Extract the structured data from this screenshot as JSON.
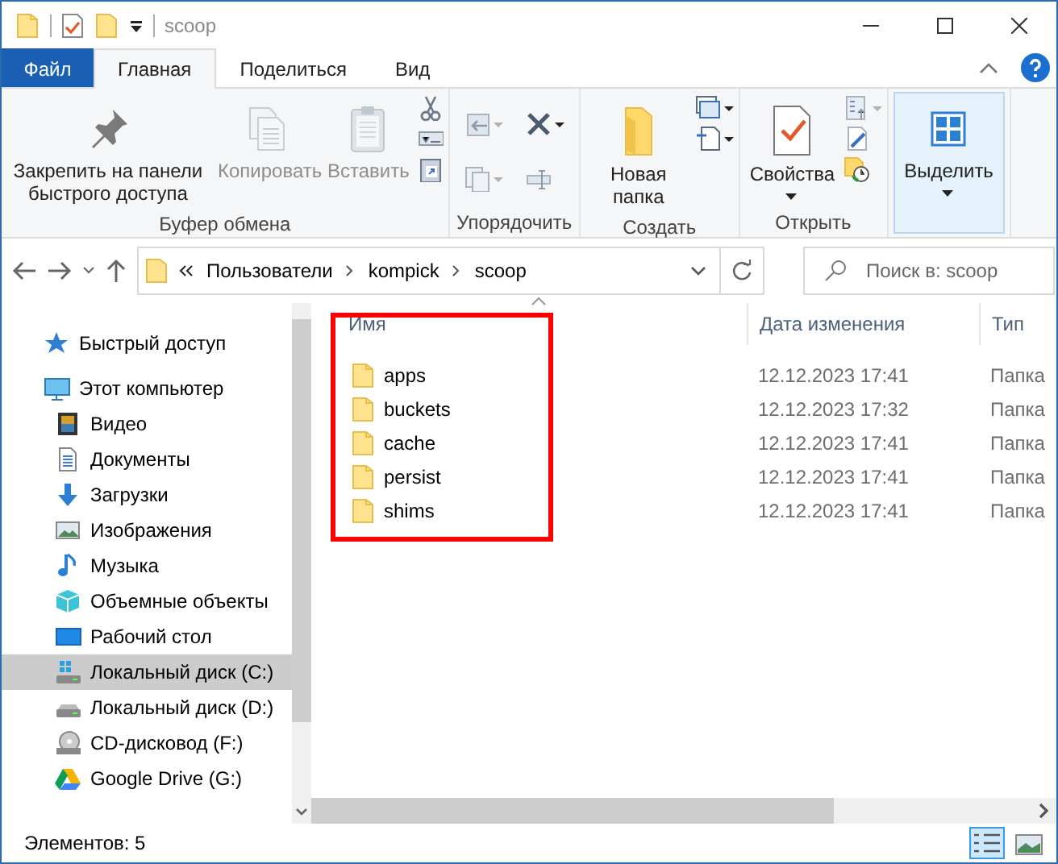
{
  "window": {
    "title": "scoop"
  },
  "ribbon_tabs": [
    {
      "label": "Файл",
      "kind": "file",
      "selected": false
    },
    {
      "label": "Главная",
      "kind": "tab",
      "selected": true
    },
    {
      "label": "Поделиться",
      "kind": "tab",
      "selected": false
    },
    {
      "label": "Вид",
      "kind": "tab",
      "selected": false
    }
  ],
  "ribbon_groups": [
    {
      "label": "Буфер обмена",
      "buttons": [
        {
          "label": "Закрепить на панели быстрого доступа",
          "disabled": false,
          "dropdown": false,
          "highlighted": false
        },
        {
          "label": "Копировать",
          "disabled": true,
          "dropdown": false,
          "highlighted": false
        },
        {
          "label": "Вставить",
          "disabled": true,
          "dropdown": false,
          "highlighted": false
        }
      ]
    },
    {
      "label": "Упорядочить"
    },
    {
      "label": "Создать",
      "buttons": [
        {
          "label": "Новая папка",
          "disabled": false,
          "dropdown": false,
          "highlighted": false
        }
      ]
    },
    {
      "label": "Открыть",
      "buttons": [
        {
          "label": "Свойства",
          "disabled": false,
          "dropdown": true,
          "highlighted": false
        }
      ]
    },
    {
      "buttons": [
        {
          "label": "Выделить",
          "disabled": false,
          "dropdown": true,
          "highlighted": true
        }
      ]
    }
  ],
  "address_bar": {
    "path": [
      "Пользователи",
      "kompick",
      "scoop"
    ]
  },
  "search": {
    "placeholder": "Поиск в: scoop"
  },
  "navigation": [
    {
      "label": "Быстрый доступ",
      "selected": false
    },
    {
      "label": "Этот компьютер",
      "selected": false,
      "children": [
        {
          "label": "Видео",
          "selected": false
        },
        {
          "label": "Документы",
          "selected": false
        },
        {
          "label": "Загрузки",
          "selected": false
        },
        {
          "label": "Изображения",
          "selected": false
        },
        {
          "label": "Музыка",
          "selected": false
        },
        {
          "label": "Объемные объекты",
          "selected": false
        },
        {
          "label": "Рабочий стол",
          "selected": false
        },
        {
          "label": "Локальный диск (C:)",
          "selected": true
        },
        {
          "label": "Локальный диск (D:)",
          "selected": false
        },
        {
          "label": "CD-дисковод (F:)",
          "selected": false
        },
        {
          "label": "Google Drive (G:)",
          "selected": false
        }
      ]
    }
  ],
  "file_list": {
    "columns": [
      "Имя",
      "Дата изменения",
      "Тип"
    ],
    "name_column_highlighted": true,
    "rows": [
      {
        "name": "apps",
        "modified": "12.12.2023 17:41",
        "type": "Папка"
      },
      {
        "name": "buckets",
        "modified": "12.12.2023 17:32",
        "type": "Папка"
      },
      {
        "name": "cache",
        "modified": "12.12.2023 17:41",
        "type": "Папка"
      },
      {
        "name": "persist",
        "modified": "12.12.2023 17:41",
        "type": "Папка"
      },
      {
        "name": "shims",
        "modified": "12.12.2023 17:41",
        "type": "Папка"
      }
    ]
  },
  "status_bar": {
    "text": "Элементов: 5",
    "view_buttons": [
      {
        "selected": true
      },
      {
        "selected": false
      }
    ]
  }
}
